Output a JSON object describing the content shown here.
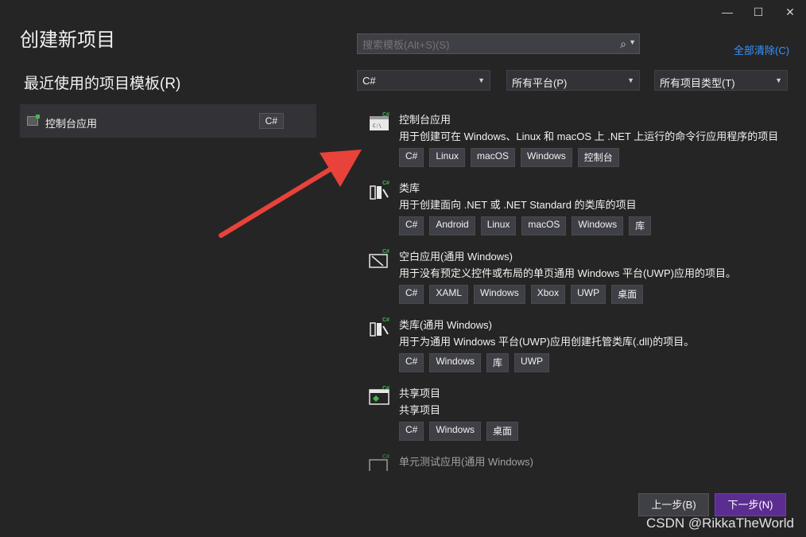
{
  "window_controls": {
    "minimize": "—",
    "maximize": "☐",
    "close": "✕"
  },
  "title": "创建新项目",
  "recent": {
    "title": "最近使用的项目模板(R)",
    "items": [
      {
        "label": "控制台应用",
        "tag": "C#",
        "icon": "console-app-icon"
      }
    ]
  },
  "search": {
    "placeholder": "搜索模板(Alt+S)(S)",
    "value": ""
  },
  "clear_all": "全部清除(C)",
  "filters": {
    "language": "C#",
    "platform": "所有平台(P)",
    "project_type": "所有项目类型(T)"
  },
  "templates": [
    {
      "name": "控制台应用",
      "desc": "用于创建可在 Windows、Linux 和 macOS 上 .NET 上运行的命令行应用程序的项目",
      "tags": [
        "C#",
        "Linux",
        "macOS",
        "Windows",
        "控制台"
      ],
      "icon": "console-app-icon"
    },
    {
      "name": "类库",
      "desc": "用于创建面向 .NET 或 .NET Standard 的类库的项目",
      "tags": [
        "C#",
        "Android",
        "Linux",
        "macOS",
        "Windows",
        "库"
      ],
      "icon": "class-library-icon"
    },
    {
      "name": "空白应用(通用 Windows)",
      "desc": "用于没有预定义控件或布局的单页通用 Windows 平台(UWP)应用的项目。",
      "tags": [
        "C#",
        "XAML",
        "Windows",
        "Xbox",
        "UWP",
        "桌面"
      ],
      "icon": "blank-app-icon"
    },
    {
      "name": "类库(通用 Windows)",
      "desc": "用于为通用 Windows 平台(UWP)应用创建托管类库(.dll)的项目。",
      "tags": [
        "C#",
        "Windows",
        "库",
        "UWP"
      ],
      "icon": "class-library-icon"
    },
    {
      "name": "共享项目",
      "desc": "共享项目",
      "tags": [
        "C#",
        "Windows",
        "桌面"
      ],
      "icon": "shared-project-icon"
    },
    {
      "name": "单元测试应用(通用 Windows)",
      "desc": "",
      "tags": [],
      "icon": "unit-test-icon"
    }
  ],
  "buttons": {
    "back": "上一步(B)",
    "next": "下一步(N)"
  },
  "watermark": "CSDN @RikkaTheWorld",
  "colors": {
    "background": "#252526",
    "accent": "#5c2d91",
    "link": "#3794ff",
    "arrow": "#e8423a"
  }
}
